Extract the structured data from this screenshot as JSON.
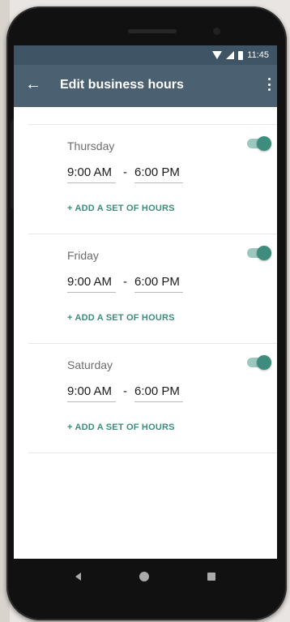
{
  "status_bar": {
    "time": "11:45"
  },
  "app_bar": {
    "title": "Edit business hours"
  },
  "days": [
    {
      "name": "Thursday",
      "start": "9:00 AM",
      "separator": "-",
      "end": "6:00 PM",
      "add_label": "+ ADD A SET OF HOURS",
      "enabled": true
    },
    {
      "name": "Friday",
      "start": "9:00 AM",
      "separator": "-",
      "end": "6:00 PM",
      "add_label": "+ ADD A SET OF HOURS",
      "enabled": true
    },
    {
      "name": "Saturday",
      "start": "9:00 AM",
      "separator": "-",
      "end": "6:00 PM",
      "add_label": "+ ADD A SET OF HOURS",
      "enabled": true
    }
  ],
  "colors": {
    "accent": "#3d8c7d",
    "app_bar": "#4b6070",
    "status_bar": "#3f5566"
  },
  "icons": {
    "back": "arrow-left-icon",
    "menu": "more-vertical-icon",
    "wifi": "wifi-icon",
    "signal": "signal-icon",
    "battery": "battery-icon",
    "nav_back": "nav-back-icon",
    "nav_home": "nav-home-icon",
    "nav_recent": "nav-recent-icon"
  }
}
